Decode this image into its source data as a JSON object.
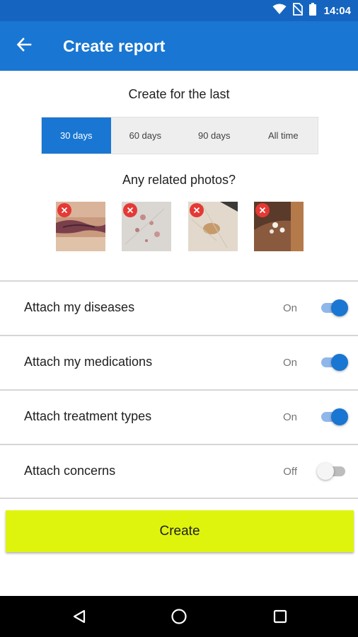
{
  "status_bar": {
    "time": "14:04",
    "icons": [
      "wifi-icon",
      "no-sim-icon",
      "battery-icon"
    ]
  },
  "app_bar": {
    "title": "Create report",
    "back_icon": "arrow-back-icon",
    "color": "#1976d2"
  },
  "period": {
    "label": "Create for the last",
    "options": [
      "30 days",
      "60 days",
      "90 days",
      "All time"
    ],
    "selected": "30 days"
  },
  "photos": {
    "label": "Any related photos?",
    "count": 4,
    "remove_icon": "close-icon"
  },
  "options": [
    {
      "label": "Attach my diseases",
      "state": "On",
      "on": true
    },
    {
      "label": "Attach my medications",
      "state": "On",
      "on": true
    },
    {
      "label": "Attach treatment types",
      "state": "On",
      "on": true
    },
    {
      "label": "Attach concerns",
      "state": "Off",
      "on": false
    }
  ],
  "create_button": {
    "label": "Create",
    "color": "#dff40c"
  },
  "nav": {
    "icons": [
      "back-triangle-icon",
      "home-circle-icon",
      "recents-square-icon"
    ]
  }
}
